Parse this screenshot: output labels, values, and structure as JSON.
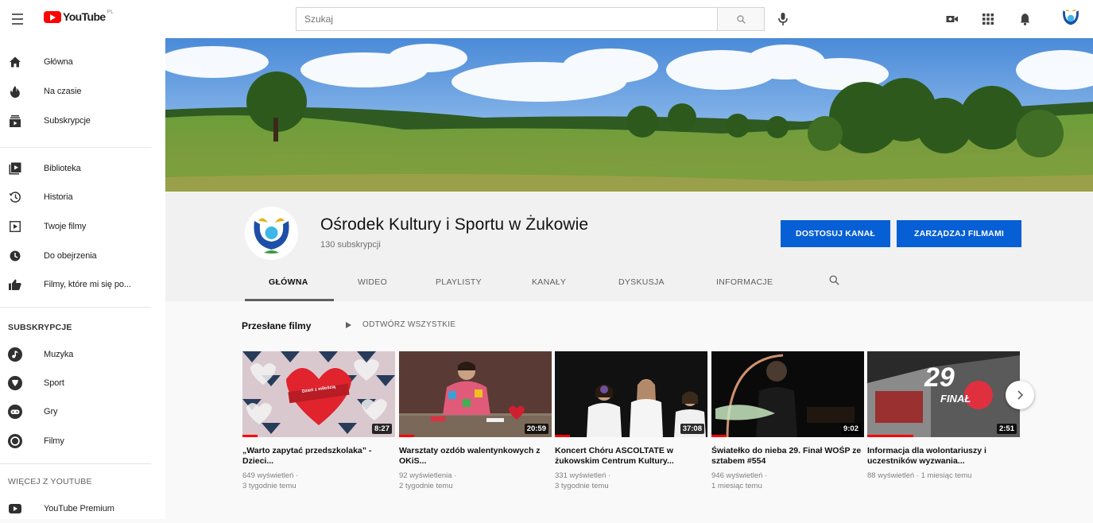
{
  "app": {
    "logo_text": "YouTube",
    "logo_region": "PL"
  },
  "search": {
    "placeholder": "Szukaj"
  },
  "sidebar": {
    "main": [
      {
        "label": "Główna",
        "icon": "home-icon"
      },
      {
        "label": "Na czasie",
        "icon": "trending-icon"
      },
      {
        "label": "Subskrypcje",
        "icon": "subscriptions-icon"
      }
    ],
    "library": [
      {
        "label": "Biblioteka",
        "icon": "library-icon"
      },
      {
        "label": "Historia",
        "icon": "history-icon"
      },
      {
        "label": "Twoje filmy",
        "icon": "your-videos-icon"
      },
      {
        "label": "Do obejrzenia",
        "icon": "watch-later-icon"
      },
      {
        "label": "Filmy, które mi się po...",
        "icon": "liked-icon"
      }
    ],
    "subs_heading": "SUBSKRYPCJE",
    "subscriptions": [
      {
        "label": "Muzyka",
        "icon": "music-icon"
      },
      {
        "label": "Sport",
        "icon": "sport-icon"
      },
      {
        "label": "Gry",
        "icon": "gaming-icon"
      },
      {
        "label": "Filmy",
        "icon": "films-icon"
      }
    ],
    "more_heading": "WIĘCEJ Z YOUTUBE",
    "more": [
      {
        "label": "YouTube Premium",
        "icon": "youtube-premium-icon"
      }
    ]
  },
  "channel": {
    "name": "Ośrodek Kultury i Sportu w Żukowie",
    "subscribers": "130 subskrypcji",
    "customize_button": "DOSTOSUJ KANAŁ",
    "manage_button": "ZARZĄDZAJ FILMAMI",
    "tabs": [
      "GŁÓWNA",
      "WIDEO",
      "PLAYLISTY",
      "KANAŁY",
      "DYSKUSJA",
      "INFORMACJE"
    ]
  },
  "section": {
    "title": "Przesłane filmy",
    "play_all": "ODTWÓRZ WSZYSTKIE"
  },
  "videos": [
    {
      "title": "„Warto zapytać przedszkolaka” - Dzieci...",
      "views": "649 wyświetleń ·",
      "age": "3 tygodnie temu",
      "duration": "8:27",
      "progress": 0.1
    },
    {
      "title": "Warsztaty ozdób walentynkowych z OKiS...",
      "views": "92 wyświetlenia ·",
      "age": "2 tygodnie temu",
      "duration": "20:59",
      "progress": 0.1
    },
    {
      "title": "Koncert Chóru ASCOLTATE w żukowskim Centrum Kultury...",
      "views": "331 wyświetleń ·",
      "age": "3 tygodnie temu",
      "duration": "37:08",
      "progress": 0.1
    },
    {
      "title": "Światełko do nieba 29. Finał WOŚP ze sztabem #554",
      "views": "946 wyświetleń ·",
      "age": "1 miesiąc temu",
      "duration": "9:02",
      "progress": 0.1
    },
    {
      "title": "Informacja dla wolontariuszy i uczestników wyzwania...",
      "views": "88 wyświetleń · 1 miesiąc temu",
      "age": "",
      "duration": "2:51",
      "progress": 0.3
    }
  ],
  "thumb_text": {
    "heart_banner": "Dzień z miłością",
    "finale_number": "29",
    "finale_word": "FINAŁ"
  }
}
